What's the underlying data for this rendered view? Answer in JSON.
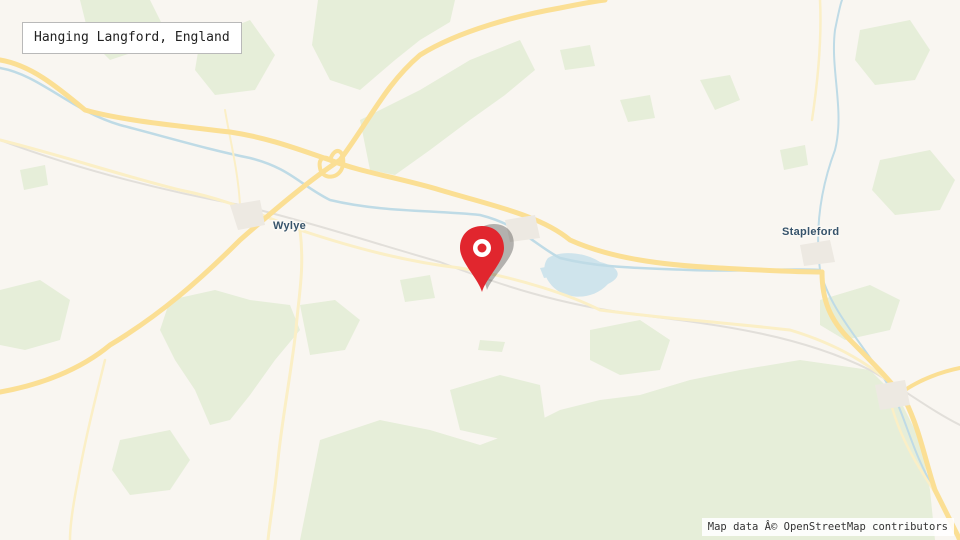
{
  "map": {
    "title": "Hanging Langford, England",
    "attribution": "Map data Â© OpenStreetMap contributors",
    "places": [
      {
        "name": "Wylye"
      },
      {
        "name": "Stapleford"
      }
    ],
    "marker_icon": "map-pin-icon",
    "colors": {
      "land": "#f9f6f1",
      "woodland": "#e6eed9",
      "major_road": "#fbdf94",
      "minor_road": "#fbefc6",
      "water": "#cfe4ec",
      "rail": "#e2dfda",
      "place_label": "#36536b",
      "marker": "#e1262e"
    }
  }
}
